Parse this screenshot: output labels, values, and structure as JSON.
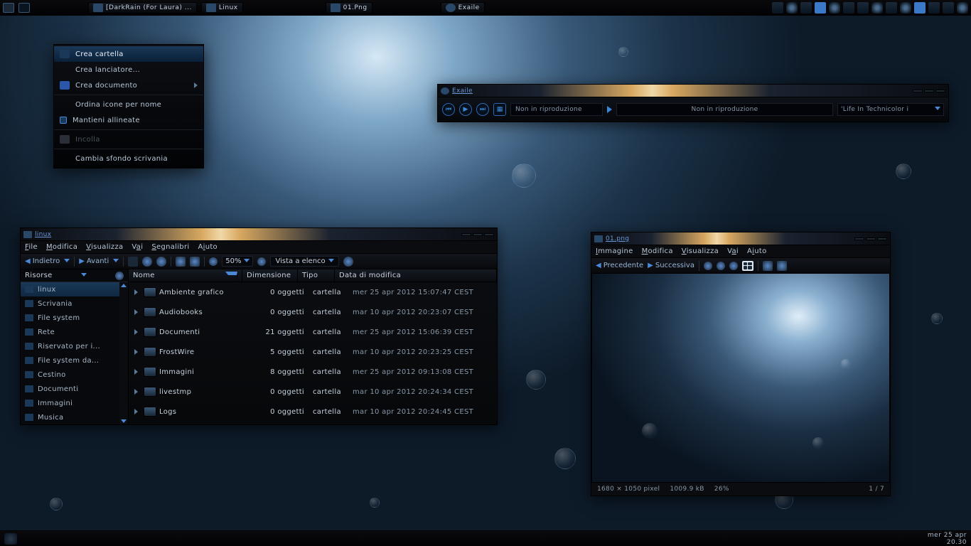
{
  "taskbar": {
    "tasks": [
      {
        "label": "[DarkRain (for Laura) ..."
      },
      {
        "label": "linux"
      },
      {
        "label": "01.png"
      },
      {
        "label": "Exaile"
      }
    ]
  },
  "bottombar": {
    "date": "mer 25 apr",
    "time": "20.30"
  },
  "context_menu": {
    "create_folder": "Crea cartella",
    "create_launcher": "Crea lanciatore...",
    "create_document": "Crea documento",
    "sort_by_name": "Ordina icone per nome",
    "keep_aligned": "Mantieni allineate",
    "paste": "Incolla",
    "change_wallpaper": "Cambia sfondo scrivania"
  },
  "exaile": {
    "title": "Exaile",
    "not_playing": "Non in riproduzione",
    "track": "'Life In Technicolor i"
  },
  "nautilus": {
    "title": "linux",
    "menus": {
      "file": "File",
      "edit": "Modifica",
      "view": "Visualizza",
      "go": "Vai",
      "bookmarks": "Segnalibri",
      "help": "Aiuto"
    },
    "toolbar": {
      "back": "Indietro",
      "forward": "Avanti",
      "zoom": "50%",
      "viewmode": "Vista a elenco"
    },
    "sidebar": {
      "header": "Risorse",
      "items": [
        {
          "label": "linux"
        },
        {
          "label": "Scrivania"
        },
        {
          "label": "File system"
        },
        {
          "label": "Rete"
        },
        {
          "label": "Riservato per i..."
        },
        {
          "label": "File system da..."
        },
        {
          "label": "Cestino"
        },
        {
          "label": "Documenti"
        },
        {
          "label": "Immagini"
        },
        {
          "label": "Musica"
        }
      ]
    },
    "columns": {
      "name": "Nome",
      "size": "Dimensione",
      "type": "Tipo",
      "modified": "Data di modifica"
    },
    "rows": [
      {
        "name": "Ambiente grafico",
        "size": "0 oggetti",
        "type": "cartella",
        "date": "mer 25 apr 2012 15:07:47 CEST"
      },
      {
        "name": "Audiobooks",
        "size": "0 oggetti",
        "type": "cartella",
        "date": "mar 10 apr 2012 20:23:07 CEST"
      },
      {
        "name": "Documenti",
        "size": "21 oggetti",
        "type": "cartella",
        "date": "mer 25 apr 2012 15:06:39 CEST"
      },
      {
        "name": "FrostWire",
        "size": "5 oggetti",
        "type": "cartella",
        "date": "mar 10 apr 2012 20:23:25 CEST"
      },
      {
        "name": "Immagini",
        "size": "8 oggetti",
        "type": "cartella",
        "date": "mer 25 apr 2012 09:13:08 CEST"
      },
      {
        "name": "livestmp",
        "size": "0 oggetti",
        "type": "cartella",
        "date": "mar 10 apr 2012 20:24:34 CEST"
      },
      {
        "name": "Logs",
        "size": "0 oggetti",
        "type": "cartella",
        "date": "mar 10 apr 2012 20:24:45 CEST"
      }
    ]
  },
  "imageviewer": {
    "title": "01.png",
    "menus": {
      "image": "Immagine",
      "edit": "Modifica",
      "view": "Visualizza",
      "go": "Vai",
      "help": "Aiuto"
    },
    "toolbar": {
      "prev": "Precedente",
      "next": "Successiva"
    },
    "status": {
      "dims": "1680 × 1050 pixel",
      "size": "1009.9 kB",
      "zoom": "26%",
      "page": "1 / 7"
    }
  }
}
